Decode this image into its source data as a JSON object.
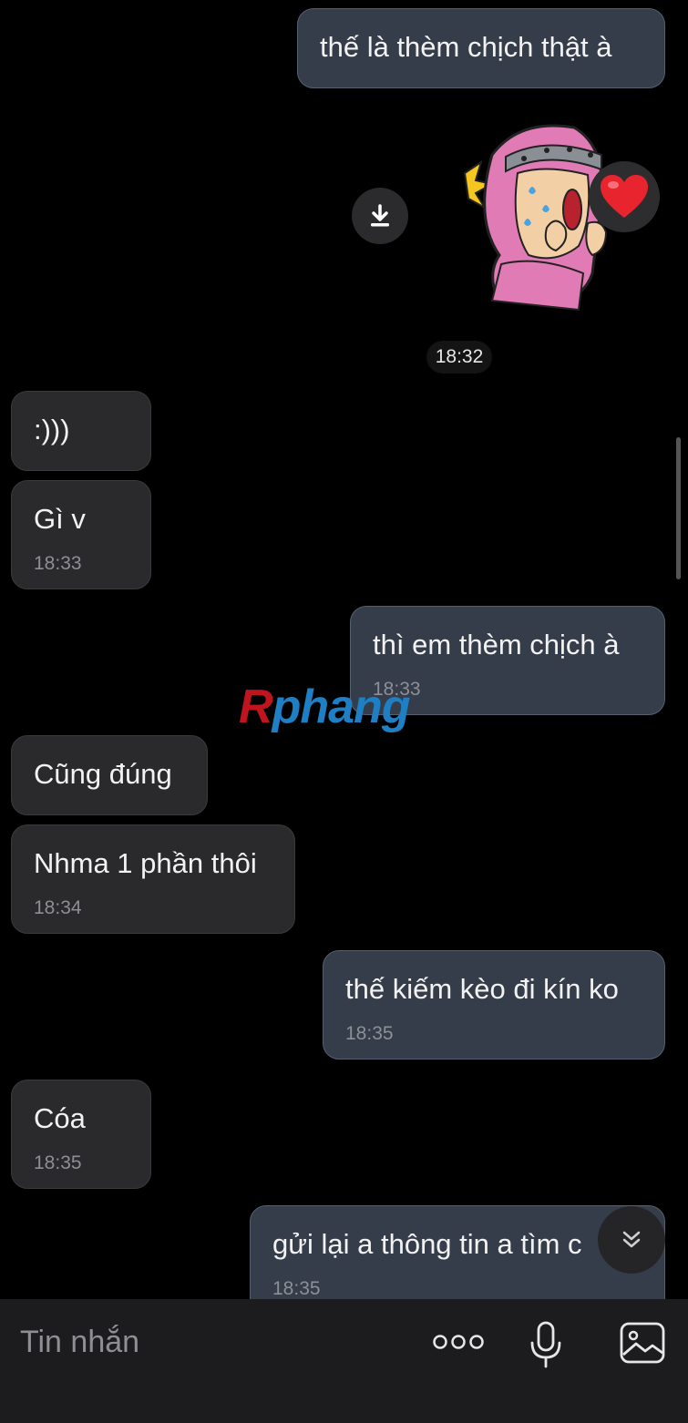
{
  "messages": [
    {
      "side": "out",
      "text": "thế là thèm chịch thật à",
      "time": ""
    },
    {
      "side": "in",
      "text": ":)))",
      "time": ""
    },
    {
      "side": "in",
      "text": "Gì v",
      "time": "18:33"
    },
    {
      "side": "out",
      "text": "thì em thèm chịch à",
      "time": "18:33"
    },
    {
      "side": "in",
      "text": "Cũng đúng",
      "time": ""
    },
    {
      "side": "in",
      "text": "Nhma 1 phần thôi",
      "time": "18:34"
    },
    {
      "side": "out",
      "text": "thế kiếm kèo đi kín ko",
      "time": "18:35"
    },
    {
      "side": "in",
      "text": "Cóa",
      "time": "18:35"
    },
    {
      "side": "out",
      "text": "gửi lại a thông tin a tìm c",
      "time": "18:35"
    }
  ],
  "sticker": {
    "time": "18:32",
    "reaction": "heart",
    "description_icon": "sticker-pink-hood-character"
  },
  "watermark": {
    "first": "R",
    "rest": "phang"
  },
  "composer": {
    "placeholder": "Tin nhắn"
  },
  "icons": {
    "download": "download-icon",
    "heart": "heart-icon",
    "scroll_down": "chevron-double-down-icon",
    "more": "more-dots-icon",
    "mic": "microphone-icon",
    "image": "image-icon"
  },
  "colors": {
    "background": "#000000",
    "incoming_bubble": "#2a2a2c",
    "outgoing_bubble": "#363d4a",
    "timestamp": "#8d8f94",
    "heart": "#e8252e"
  }
}
